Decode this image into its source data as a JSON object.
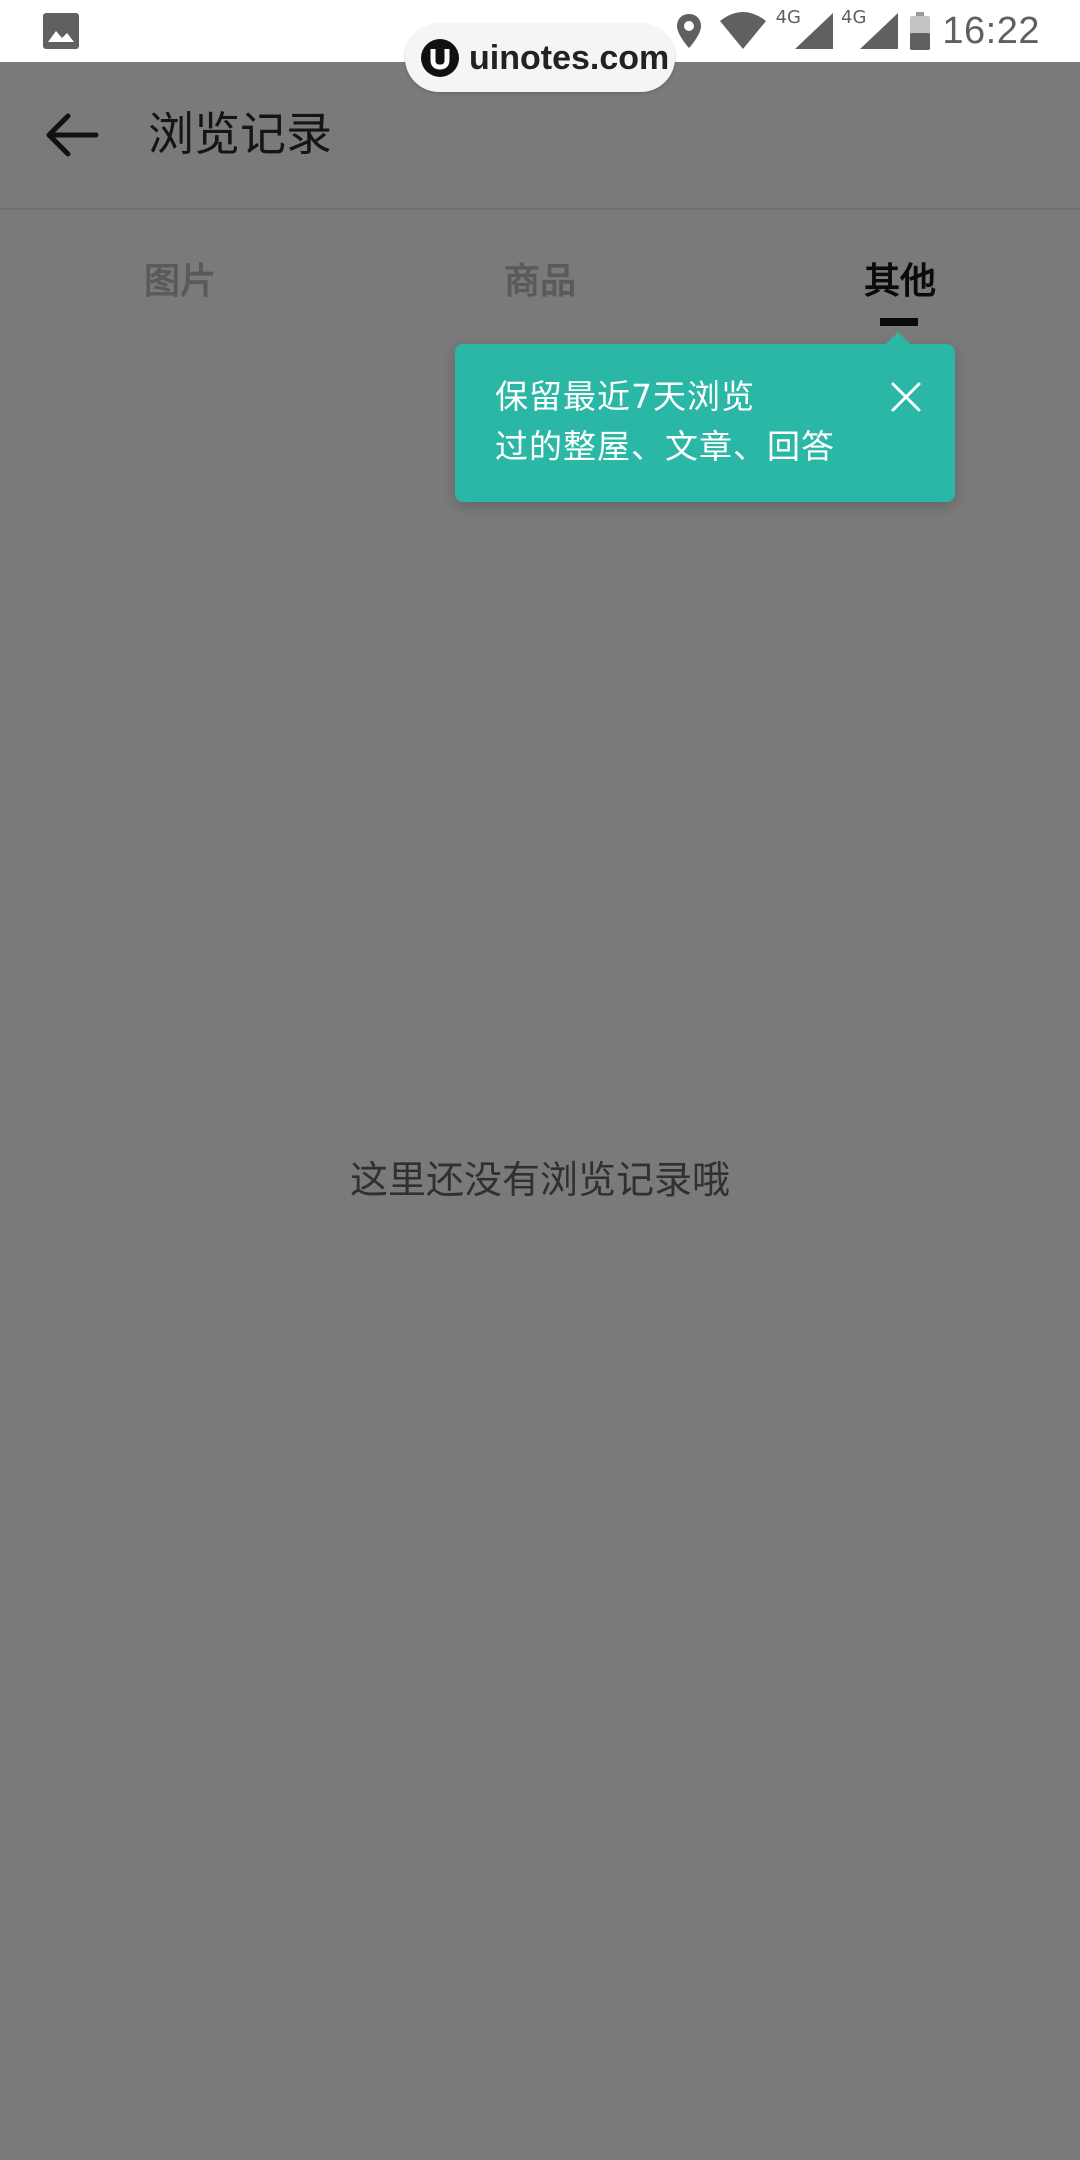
{
  "status_bar": {
    "time": "16:22",
    "network_1": "4G",
    "network_2": "4G",
    "icons": [
      "image-icon",
      "location-icon",
      "wifi-icon",
      "signal-icon",
      "battery-icon"
    ]
  },
  "watermark": {
    "text": "uinotes.com"
  },
  "header": {
    "title": "浏览记录",
    "back_icon": "arrow-left-icon"
  },
  "tabs": [
    {
      "label": "图片",
      "active": false
    },
    {
      "label": "商品",
      "active": false
    },
    {
      "label": "其他",
      "active": true
    }
  ],
  "tooltip": {
    "line1": "保留最近7天浏览",
    "line2": "过的整屋、文章、回答",
    "close_icon": "close-icon",
    "color": "#2bb7a5"
  },
  "empty_state": {
    "message": "这里还没有浏览记录哦"
  }
}
